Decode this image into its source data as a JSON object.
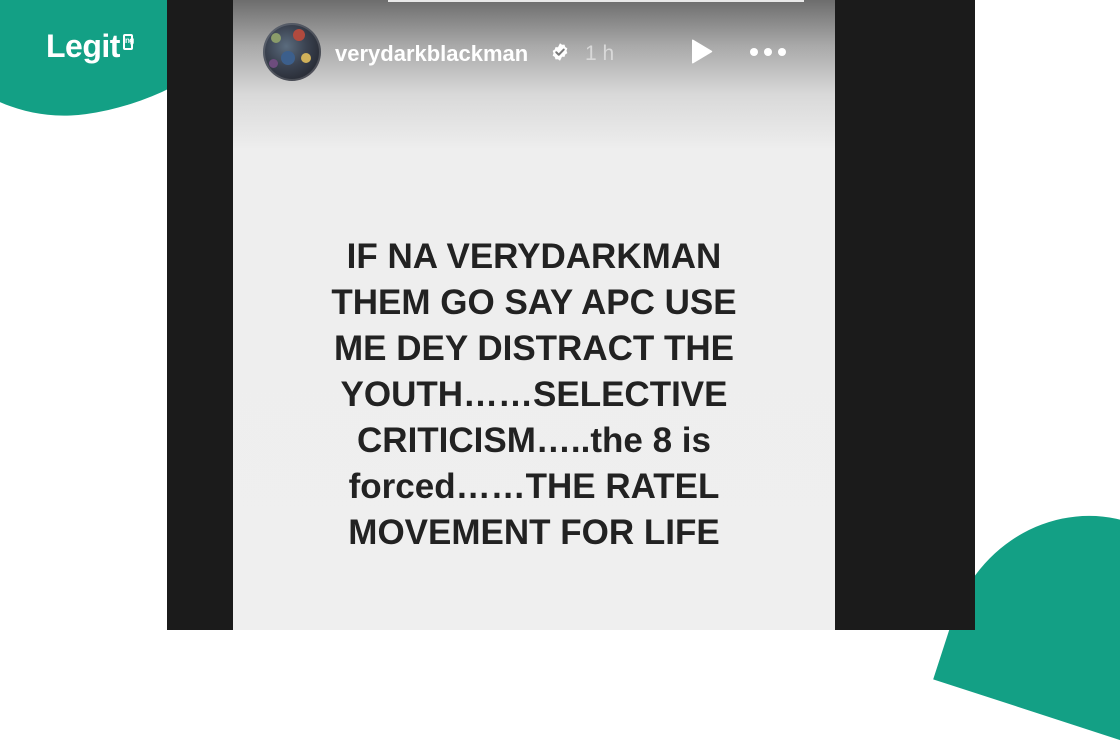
{
  "brand": {
    "logo_text": "Legit",
    "logo_suffix": "ng"
  },
  "story": {
    "username": "verydarkblackman",
    "time_ago": "1 h",
    "icons": {
      "verified": "verified-badge-icon",
      "play": "play-icon",
      "more": "more-options-icon"
    },
    "text_lines": [
      "IF NA VERYDARKMAN",
      "THEM GO SAY APC USE",
      "ME DEY DISTRACT THE",
      "YOUTH……SELECTIVE",
      "CRITICISM…..the 8 is",
      "forced……THE RATEL",
      "MOVEMENT FOR LIFE"
    ]
  },
  "colors": {
    "brand_green": "#13a085",
    "frame_dark": "#1b1b1b",
    "story_bg": "#efefef",
    "text": "#222222"
  }
}
